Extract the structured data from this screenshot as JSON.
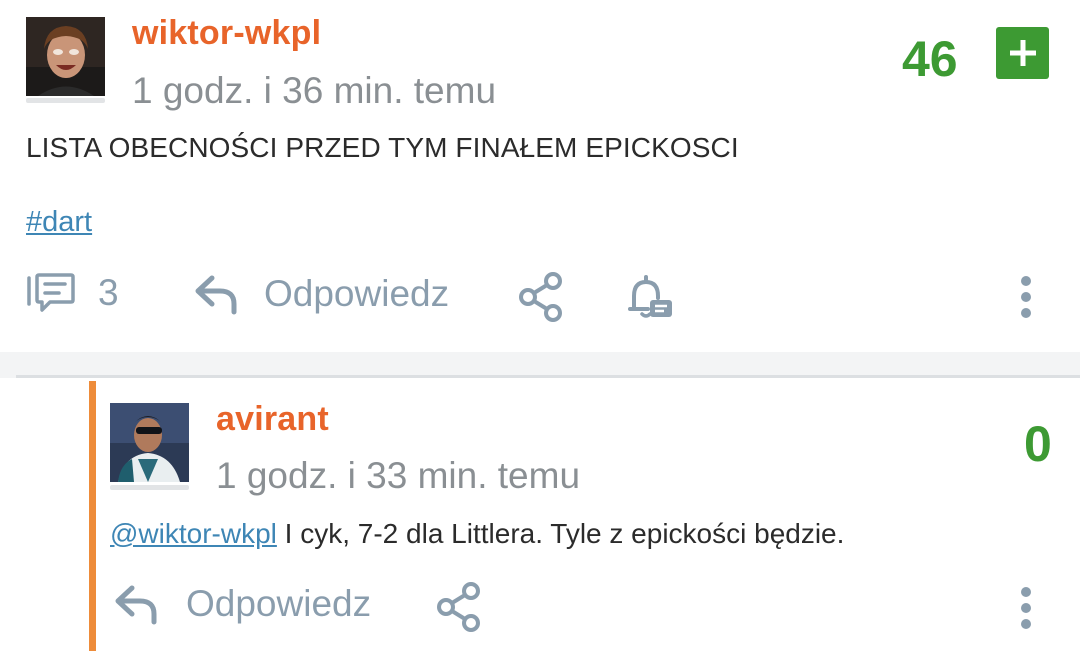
{
  "entry": {
    "author": "wiktor-wkpl",
    "time": "1 godz. i 36 min. temu",
    "score": "46",
    "body": "LISTA OBECNOŚCI PRZED TYM FINAŁEM EPICKOSCI",
    "tag": "#dart",
    "comment_count": "3",
    "reply_label": "Odpowiedz"
  },
  "reply": {
    "author": "avirant",
    "time": "1 godz. i 33 min. temu",
    "score": "0",
    "mention": "@wiktor-wkpl",
    "text": " I cyk, 7-2 dla Littlera. Tyle z epickości będzie.",
    "reply_label": "Odpowiedz"
  },
  "colors": {
    "username": "#e8642a",
    "score": "#3d9a33",
    "link": "#3e86b5",
    "action": "#8a9dad",
    "reply_bar": "#ee8c3a"
  },
  "icons": {
    "comments": "comments-icon",
    "reply": "reply-arrow-icon",
    "share": "share-icon",
    "notify": "bell-icon",
    "more": "more-vertical-icon",
    "plus": "plus-icon"
  }
}
